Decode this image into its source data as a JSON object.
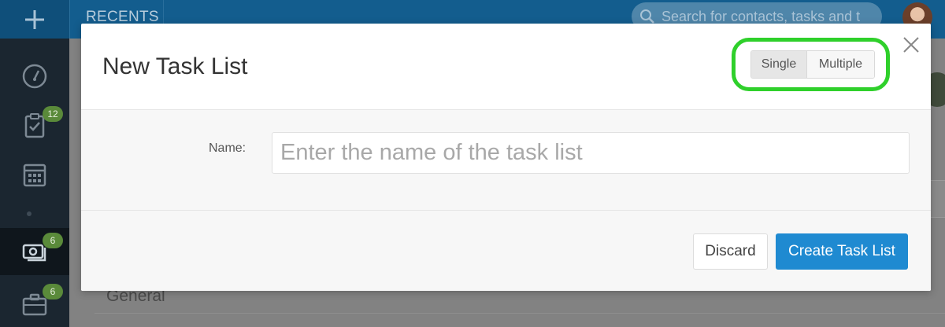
{
  "topbar": {
    "recents_label": "RECENTS",
    "search_placeholder": "Search for contacts, tasks and t"
  },
  "sidebar": {
    "items": [
      {
        "icon": "dashboard-icon",
        "badge": ""
      },
      {
        "icon": "clipboard-check-icon",
        "badge": "12"
      },
      {
        "icon": "calendar-icon",
        "badge": ""
      },
      {
        "icon": "money-icon",
        "badge": "6"
      },
      {
        "icon": "briefcase-icon",
        "badge": "6"
      }
    ]
  },
  "background": {
    "section_label": "General"
  },
  "modal": {
    "title": "New Task List",
    "mode_options": [
      "Single",
      "Multiple"
    ],
    "selected_mode": "Single",
    "name_label": "Name:",
    "name_placeholder": "Enter the name of the task list",
    "name_value": "",
    "discard_label": "Discard",
    "create_label": "Create Task List"
  },
  "colors": {
    "topbar": "#135d8e",
    "sidebar": "#1b2630",
    "primary_button": "#1f8ad1",
    "highlight": "#2fd02b",
    "badge": "#5a8a3a"
  }
}
